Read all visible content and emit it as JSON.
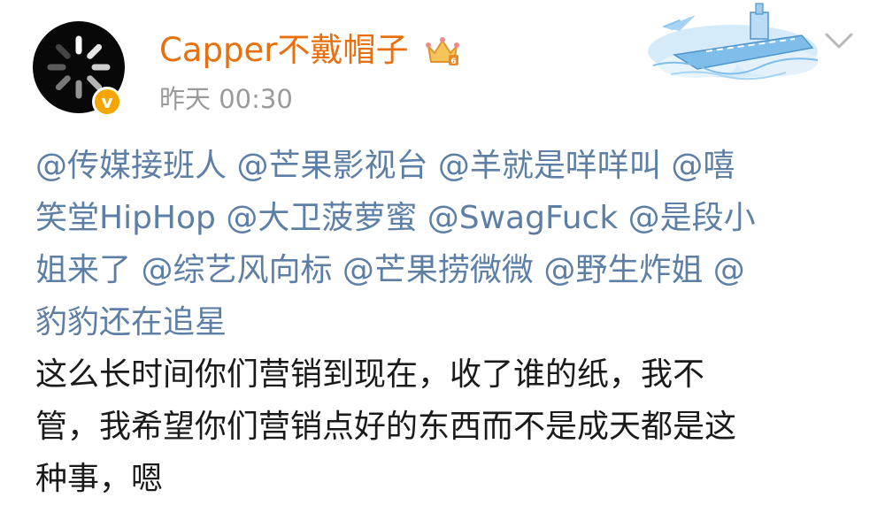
{
  "post": {
    "username": "Capper不戴帽子",
    "timestamp": "昨天 00:30",
    "mentions_line1": "@传媒接班人 @芒果影视台 @羊就是咩咩叫 @嘻",
    "mentions_line2": "笑堂HipHop @大卫菠萝蜜 @SwagFuck @是段小",
    "mentions_line3": "姐来了 @综艺风向标 @芒果捞微微 @野生炸姐 @",
    "mentions_line4": "豹豹还在追星",
    "body_line1": "这么长时间你们营销到现在，收了谁的纸，我不",
    "body_line2": "管，我希望你们营销点好的东西而不是成天都是这",
    "body_line3": "种事，嗯"
  },
  "colors": {
    "username": "#e8700f",
    "mention": "#5d7fa6",
    "text": "#1a1a1a",
    "timestamp": "#9a9a9a",
    "verified": "#f7a600"
  },
  "icons": {
    "avatar": "loading-spinner-avatar",
    "badge": "verified-v-icon",
    "crown": "vip-crown-icon",
    "decoration": "aircraft-carrier-decoration",
    "menu": "chevron-down-icon"
  }
}
